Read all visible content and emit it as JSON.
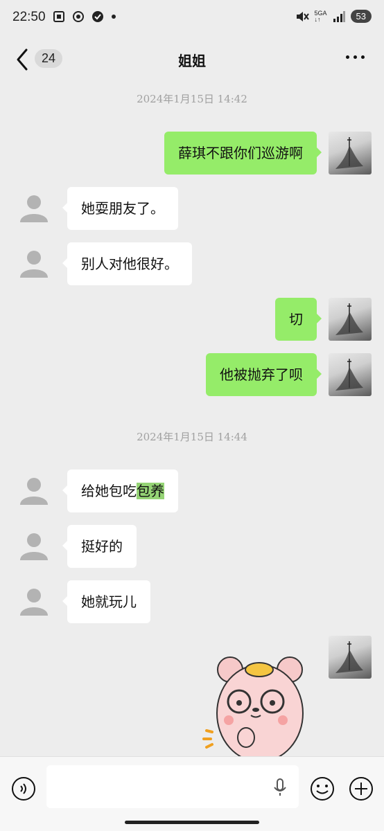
{
  "status": {
    "time": "22:50",
    "network": "5GA",
    "battery": "53"
  },
  "nav": {
    "unread_count": "24",
    "title": "姐姐"
  },
  "timestamps": [
    "2024年1月15日  14:42",
    "2024年1月15日  14:44"
  ],
  "messages": [
    {
      "dir": "out",
      "text": "薛琪不跟你们巡游啊"
    },
    {
      "dir": "in",
      "text": "她耍朋友了。"
    },
    {
      "dir": "in",
      "text": "别人对他很好。"
    },
    {
      "dir": "out",
      "text": "切"
    },
    {
      "dir": "out",
      "text": "他被抛弃了呗"
    },
    {
      "dir": "in",
      "text_plain": "给她包吃",
      "text_highlight": "包养"
    },
    {
      "dir": "in",
      "text": "挺好的"
    },
    {
      "dir": "in",
      "text": "她就玩儿"
    }
  ],
  "icons": {
    "back": "chevron-left-icon",
    "more": "more-dots-icon",
    "voice": "voice-icon",
    "mic": "mic-icon",
    "emoji": "emoji-icon",
    "plus": "plus-icon"
  },
  "colors": {
    "outgoing_bubble": "#95ec69",
    "incoming_bubble": "#ffffff",
    "background": "#ededed"
  }
}
